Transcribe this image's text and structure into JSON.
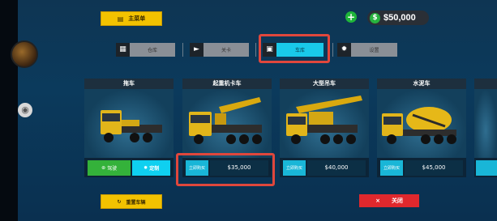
{
  "topbar": {
    "main_menu_label": "主菜单",
    "money": "$50,000",
    "plus": "+"
  },
  "tabs": [
    {
      "label": "仓库",
      "icon": "garage-icon"
    },
    {
      "label": "关卡",
      "icon": "play-icon"
    },
    {
      "label": "车库",
      "icon": "truck-icon",
      "active": true
    },
    {
      "label": "设置",
      "icon": "gear-icon"
    }
  ],
  "cards": [
    {
      "title": "拖车",
      "drive_label": "驾驶",
      "custom_label": "定制"
    },
    {
      "title": "起重机卡车",
      "buy_label": "立即购买",
      "price": "$35,000"
    },
    {
      "title": "大型吊车",
      "buy_label": "立即购买",
      "price": "$40,000"
    },
    {
      "title": "水泥车",
      "buy_label": "立即购买",
      "price": "$45,000"
    }
  ],
  "bottom": {
    "reset_label": "重置车辆",
    "close_label": "关闭",
    "close_x": "×"
  },
  "colors": {
    "accent_yellow": "#f2c200",
    "active_tab": "#19c9e9",
    "highlight_red": "#e0473c",
    "close_red": "#e0282d",
    "drive_green": "#34b23a"
  }
}
